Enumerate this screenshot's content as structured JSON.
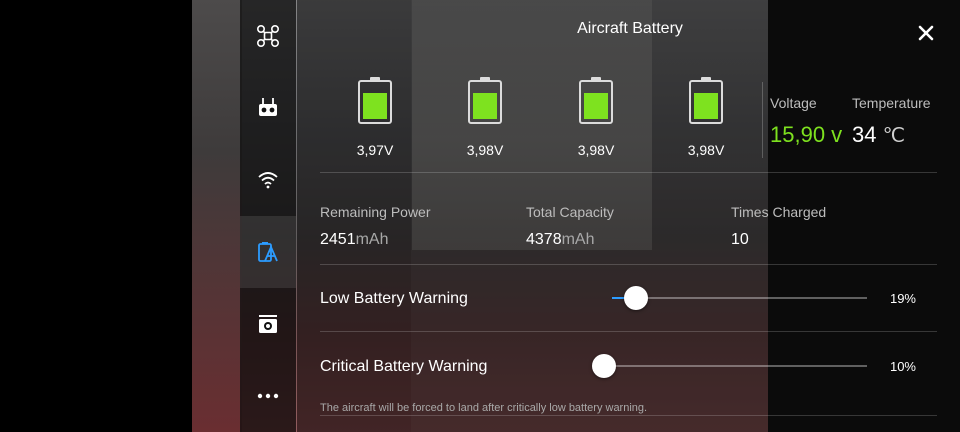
{
  "title": "Aircraft Battery",
  "sidebar": {
    "items": [
      {
        "icon": "drone-icon"
      },
      {
        "icon": "remote-controller-icon"
      },
      {
        "icon": "wifi-icon"
      },
      {
        "icon": "battery-icon",
        "active": true
      },
      {
        "icon": "camera-icon"
      },
      {
        "icon": "more-icon"
      }
    ]
  },
  "cells": [
    {
      "voltage": "3,97V",
      "level": 0.72
    },
    {
      "voltage": "3,98V",
      "level": 0.72
    },
    {
      "voltage": "3,98V",
      "level": 0.72
    },
    {
      "voltage": "3,98V",
      "level": 0.72
    }
  ],
  "voltage": {
    "label": "Voltage",
    "value": "15,90 v"
  },
  "temperature": {
    "label": "Temperature",
    "value": "34",
    "unit": "℃"
  },
  "stats": {
    "remaining_power": {
      "label": "Remaining Power",
      "value": "2451",
      "unit": "mAh"
    },
    "total_capacity": {
      "label": "Total Capacity",
      "value": "4378",
      "unit": "mAh"
    },
    "times_charged": {
      "label": "Times Charged",
      "value": "10"
    }
  },
  "low_battery": {
    "label": "Low Battery Warning",
    "percent_text": "19%",
    "level": 0.19
  },
  "critical_battery": {
    "label": "Critical Battery Warning",
    "percent_text": "10%",
    "level": 0.1
  },
  "note": "The aircraft will be forced to land after critically low battery warning.",
  "colors": {
    "accent_green": "#7ee21f",
    "slider_blue": "#2c9cff"
  }
}
